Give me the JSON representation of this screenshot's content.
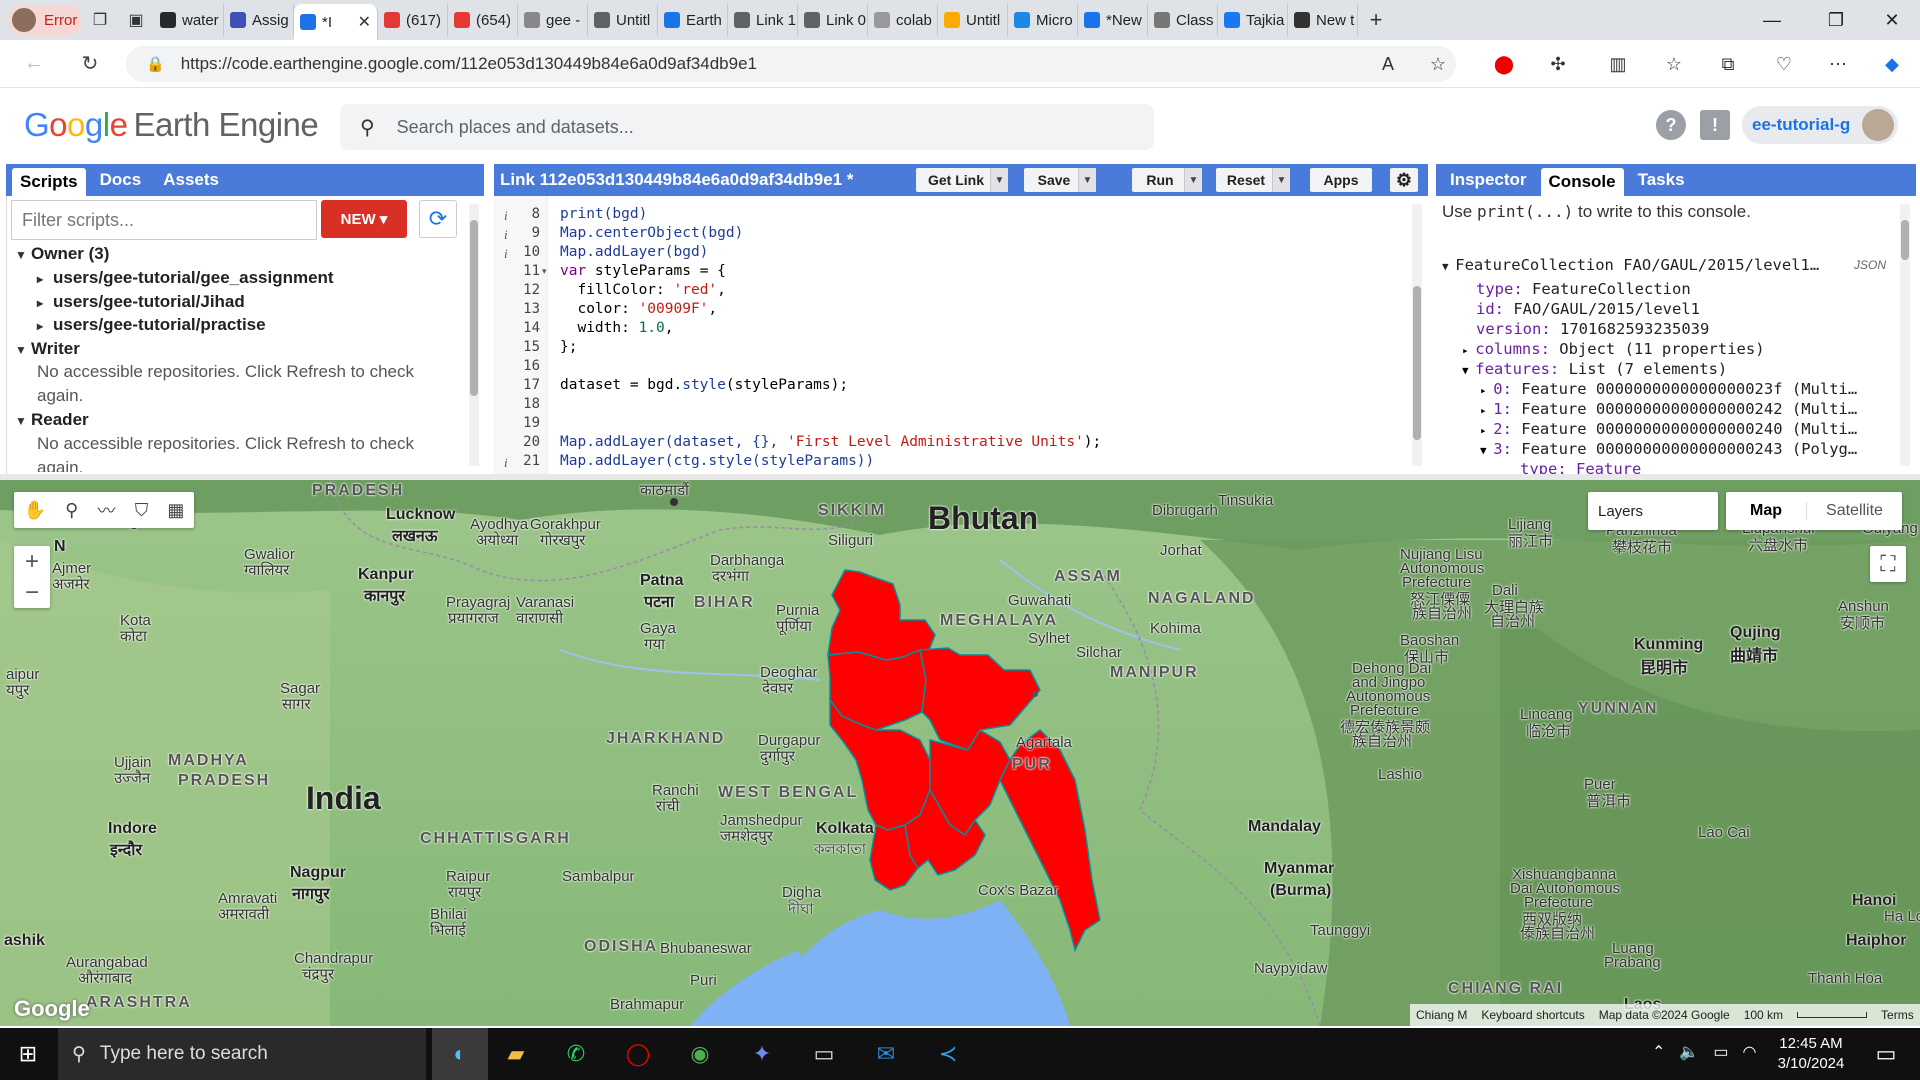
{
  "browser": {
    "profile_label": "Error",
    "tabs": [
      "water",
      "Assig",
      "*I",
      "(617)",
      "(654)",
      "gee -",
      "Untitl",
      "Earth",
      "Link 1",
      "Link 0",
      "colab",
      "Untitl",
      "Micro",
      "*New",
      "Class",
      "Tajkia",
      "New t"
    ],
    "active_tab_index": 2,
    "url": "https://code.earthengine.google.com/112e053d130449b84e6a0d9af34db9e1"
  },
  "gee": {
    "logo_google": "Google",
    "logo_product": "Earth Engine",
    "search_placeholder": "Search places and datasets...",
    "user": "ee-tutorial-g"
  },
  "left_panel": {
    "tabs": [
      "Scripts",
      "Docs",
      "Assets"
    ],
    "filter_placeholder": "Filter scripts...",
    "new_label": "NEW",
    "tree": {
      "owner": "Owner (3)",
      "repos": [
        "users/gee-tutorial/gee_assignment",
        "users/gee-tutorial/Jihad",
        "users/gee-tutorial/practise"
      ],
      "writer": "Writer",
      "writer_msg": "No accessible repositories. Click Refresh to check again.",
      "reader": "Reader",
      "reader_msg": "No accessible repositories. Click Refresh to check again."
    }
  },
  "editor": {
    "title": "Link 112e053d130449b84e6a0d9af34db9e1 *",
    "buttons": [
      "Get Link",
      "Save",
      "Run",
      "Reset",
      "Apps"
    ],
    "line_numbers": [
      "8",
      "9",
      "10",
      "11",
      "12",
      "13",
      "14",
      "15",
      "16",
      "17",
      "18",
      "19",
      "20",
      "21"
    ],
    "code": {
      "l8": "print(bgd)",
      "l9": "Map.centerObject(bgd)",
      "l10": "Map.addLayer(bgd)",
      "l11a": "var",
      "l11b": " styleParams = {",
      "l12a": "  fillColor: ",
      "l12b": "'red'",
      "l12c": ",",
      "l13a": "  color: ",
      "l13b": "'00909F'",
      "l13c": ",",
      "l14a": "  width: ",
      "l14b": "1.0",
      "l14c": ",",
      "l15": "};",
      "l17a": "dataset = bgd.",
      "l17b": "style",
      "l17c": "(styleParams);",
      "l20a": "Map.addLayer(dataset, {}, ",
      "l20b": "'First Level Administrative Units'",
      "l20c": ");",
      "l21": "Map.addLayer(ctg.style(styleParams))"
    }
  },
  "right_panel": {
    "tabs": [
      "Inspector",
      "Console",
      "Tasks"
    ],
    "hint_pre": "Use ",
    "hint_code": "print(...)",
    "hint_post": " to write to this console.",
    "json_label": "JSON",
    "fc_header": "FeatureCollection FAO/GAUL/2015/level1…",
    "type_key": "type:",
    "type_val": "FeatureCollection",
    "id_key": "id:",
    "id_val": "FAO/GAUL/2015/level1",
    "version_key": "version:",
    "version_val": "1701682593235039",
    "columns_key": "columns:",
    "columns_val": "Object (11 properties)",
    "features_key": "features:",
    "features_val": "List (7 elements)",
    "features": [
      {
        "key": "0:",
        "val": "Feature 0000000000000000023f (Multi…"
      },
      {
        "key": "1:",
        "val": "Feature 00000000000000000242 (Multi…"
      },
      {
        "key": "2:",
        "val": "Feature 00000000000000000240 (Multi…"
      },
      {
        "key": "3:",
        "val": "Feature 00000000000000000243 (Polyg…"
      }
    ],
    "sub_type": "type: Feature"
  },
  "map": {
    "layers_label": "Layers",
    "map_label": "Map",
    "satellite_label": "Satellite",
    "footer": [
      "Keyboard shortcuts",
      "Map data ©2024 Google",
      "100 km",
      "Terms"
    ],
    "footer_place": "Chiang M",
    "google_mark": "Google",
    "labels": {
      "pradesh_top": "PRADESH",
      "jaipur": "जयपुर",
      "lucknow": "Lucknow",
      "lucknow_h": "लखनऊ",
      "ayodhya": "Ayodhya",
      "ayodhya_h": "अयोध्या",
      "gorakhpur": "Gorakhpur",
      "gorakhpur_h": "गोरखपुर",
      "kathmandu_h": "काठमाडौं",
      "sikkim": "SIKKIM",
      "bhutan": "Bhutan",
      "siliguri": "Siliguri",
      "dibrugarh": "Dibrugarh",
      "tinsukia": "Tinsukia",
      "lijiang": "Lijiang",
      "lijiang_c": "丽江市",
      "panzhihua": "Panzhihua",
      "panzhihua_c": "攀枝花市",
      "liupanshui": "Liupanshui",
      "liupanshui_c": "六盘水市",
      "guiyang": "Guiyang",
      "n": "N",
      "ajmer": "Ajmer",
      "ajmer_h": "अजमेर",
      "gwalior": "Gwalior",
      "gwalior_h": "ग्वालियर",
      "kanpur": "Kanpur",
      "kanpur_h": "कानपुर",
      "prayagraj": "Prayagraj",
      "prayagraj_h": "प्रयागराज",
      "varanasi": "Varanasi",
      "varanasi_h": "वाराणसी",
      "patna": "Patna",
      "patna_h": "पटना",
      "bihar": "BIHAR",
      "darbhanga": "Darbhanga",
      "darbhanga_h": "दरभंगा",
      "purnia": "Purnia",
      "purnia_h": "पूर्णिया",
      "assam": "ASSAM",
      "jorhat": "Jorhat",
      "guwahati": "Guwahati",
      "meghalaya": "MEGHALAYA",
      "nagaland": "NAGALAND",
      "kohima": "Kohima",
      "sylhet": "Sylhet",
      "silchar": "Silchar",
      "manipur": "MANIPUR",
      "nujiang": "Nujiang Lisu",
      "nujiang2": "Autonomous",
      "nujiang3": "Prefecture",
      "nujiang_c": "怒江傈僳",
      "nujiang_c2": "族自治州",
      "dali": "Dali",
      "dali_c": "大理白族",
      "dali_c2": "自治州",
      "anshun": "Anshun",
      "anshun_c": "安顺市",
      "kota": "Kota",
      "kota_h": "कोटा",
      "sagar": "Sagar",
      "sagar_h": "सागर",
      "gaya": "Gaya",
      "gaya_h": "गया",
      "deoghar": "Deoghar",
      "deoghar_h": "देवघर",
      "kunming": "Kunming",
      "kunming_c": "昆明市",
      "qujing": "Qujing",
      "qujing_c": "曲靖市",
      "baoshan": "Baoshan",
      "baoshan_c": "保山市",
      "dehong": "Dehong Dai",
      "dehong2": "and Jingpo",
      "dehong3": "Autonomous",
      "dehong4": "Prefecture",
      "dehong_c": "德宏傣族景颇",
      "dehong_c2": "族自治州",
      "yunnan": "YUNNAN",
      "lincang": "Lincang",
      "lincang_c": "临沧市",
      "aipur": "aipur",
      "aipur_h": "यपुर",
      "ujjain": "Ujjain",
      "ujjain_h": "उज्जैन",
      "madhya": "MADHYA",
      "pradesh": "PRADESH",
      "india": "India",
      "jharkhand": "JHARKHAND",
      "durgapur": "Durgapur",
      "durgapur_h": "दुर्गापुर",
      "agartala": "Agartala",
      "pur": "PUR",
      "ranchi": "Ranchi",
      "ranchi_h": "रांची",
      "westbengal": "WEST BENGAL",
      "lashio": "Lashio",
      "puer": "Puer",
      "puer_c": "普洱市",
      "indore": "Indore",
      "indore_h": "इन्दौर",
      "jamshedpur": "Jamshedpur",
      "jamshedpur_h": "जमशेदपुर",
      "kolkata": "Kolkata",
      "kolkata_b": "কলকাতা",
      "mandalay": "Mandalay",
      "laocai": "Lào Cai",
      "chhattisgarh": "CHHATTISGARH",
      "nagpur": "Nagpur",
      "nagpur_h": "नागपुर",
      "raipur": "Raipur",
      "raipur_h": "रायपुर",
      "amravati": "Amravati",
      "amravati_h": "अमरावती",
      "sambalpur": "Sambalpur",
      "bhilai": "Bhilai",
      "bhilai_h": "भिलाई",
      "digha": "Digha",
      "digha_h": "দীঘা",
      "coxsbazar": "Cox's Bazar",
      "myanmar": "Myanmar",
      "burma": "(Burma)",
      "xishuangbanna": "Xishuangbanna",
      "xishuangbanna2": "Dai Autonomous",
      "xishuangbanna3": "Prefecture",
      "xishuangbanna_c": "西双版纳",
      "xishuangbanna_c2": "傣族自治州",
      "hanoi": "Hanoi",
      "halo": "Hạ Lo",
      "haiphor": "Haiphor",
      "ashik": "ashik",
      "aurangabad": "Aurangabad",
      "aurangabad_h": "औरंगाबाद",
      "chandrapur": "Chandrapur",
      "chandrapur_h": "चंद्रपुर",
      "odisha": "ODISHA",
      "bhubaneswar": "Bhubaneswar",
      "puri": "Puri",
      "taunggyi": "Taunggyi",
      "luang": "Luang",
      "prabang": "Prabang",
      "naypyidaw": "Naypyidaw",
      "chiangrai": "CHIANG RAI",
      "thanhhoa": "Thanh Hóa",
      "arashtra": "ARASHTRA",
      "brahmapur": "Brahmapur",
      "laos": "Laos"
    }
  },
  "taskbar": {
    "search_placeholder": "Type here to search",
    "time": "12:45 AM",
    "date": "3/10/2024"
  },
  "colors": {
    "panel_bar": "#4a7bdb",
    "polygon_fill": "#ff0000",
    "polygon_stroke": "#00909F",
    "new_button": "#d93025"
  }
}
